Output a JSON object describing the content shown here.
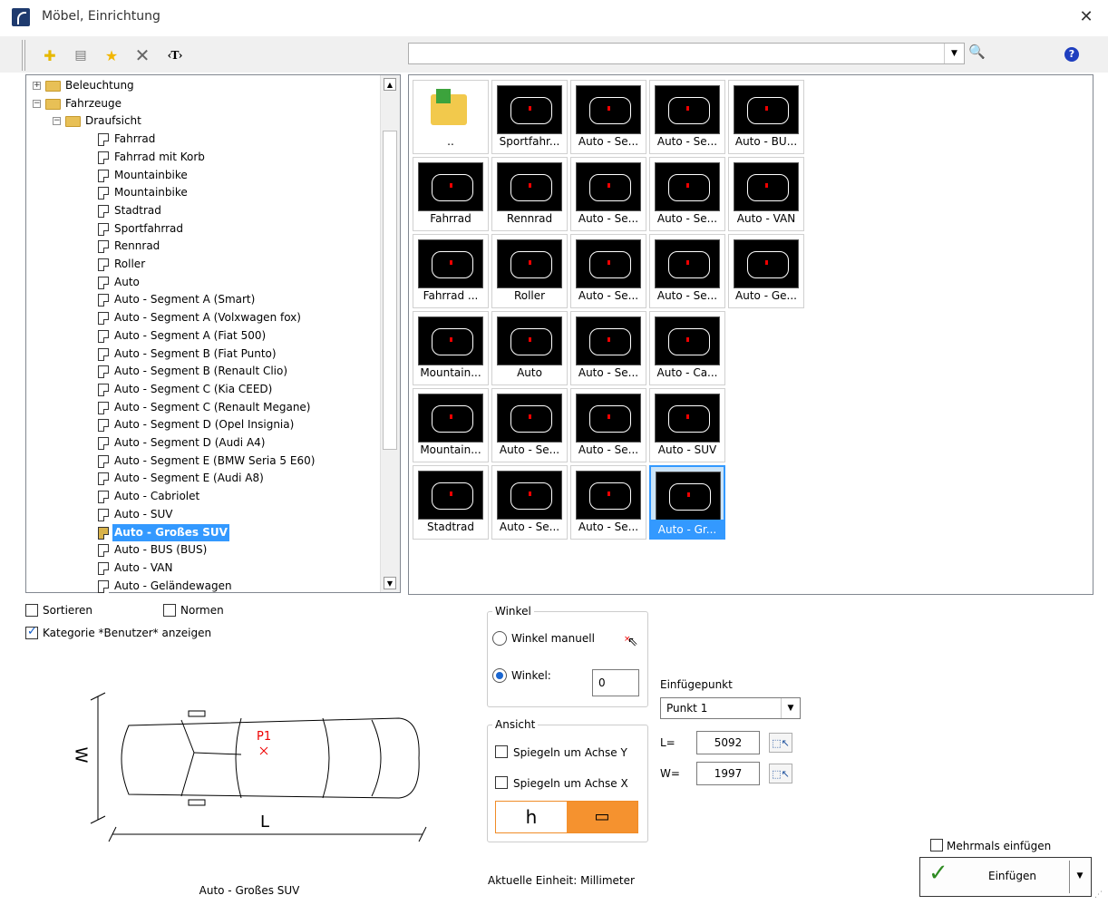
{
  "window": {
    "title": "Möbel, Einrichtung",
    "close_glyph": "✕"
  },
  "toolbar": {
    "buttons": [
      {
        "name": "add-icon",
        "glyph": "✚"
      },
      {
        "name": "properties-icon",
        "glyph": "▤"
      },
      {
        "name": "favorite-star-icon",
        "glyph": "★"
      },
      {
        "name": "delete-icon",
        "glyph": "✕"
      },
      {
        "name": "text-icon",
        "glyph": "‹T›"
      }
    ],
    "search_value": "",
    "search_glyph": "🔍",
    "help_glyph": "?"
  },
  "tree": {
    "nodes": [
      {
        "label": "Beleuchtung",
        "level": 0,
        "type": "folder",
        "toggle": "+"
      },
      {
        "label": "Fahrzeuge",
        "level": 0,
        "type": "folder",
        "toggle": "−"
      },
      {
        "label": "Draufsicht",
        "level": 1,
        "type": "folder",
        "toggle": "−"
      },
      {
        "label": "Fahrrad",
        "level": 2,
        "type": "doc"
      },
      {
        "label": "Fahrrad mit Korb",
        "level": 2,
        "type": "doc"
      },
      {
        "label": "Mountainbike",
        "level": 2,
        "type": "doc"
      },
      {
        "label": "Mountainbike",
        "level": 2,
        "type": "doc"
      },
      {
        "label": "Stadtrad",
        "level": 2,
        "type": "doc"
      },
      {
        "label": "Sportfahrrad",
        "level": 2,
        "type": "doc"
      },
      {
        "label": "Rennrad",
        "level": 2,
        "type": "doc"
      },
      {
        "label": "Roller",
        "level": 2,
        "type": "doc"
      },
      {
        "label": "Auto",
        "level": 2,
        "type": "doc"
      },
      {
        "label": "Auto - Segment A (Smart)",
        "level": 2,
        "type": "doc"
      },
      {
        "label": "Auto - Segment A (Volxwagen fox)",
        "level": 2,
        "type": "doc"
      },
      {
        "label": "Auto - Segment A (Fiat 500)",
        "level": 2,
        "type": "doc"
      },
      {
        "label": "Auto - Segment B (Fiat Punto)",
        "level": 2,
        "type": "doc"
      },
      {
        "label": "Auto - Segment B (Renault Clio)",
        "level": 2,
        "type": "doc"
      },
      {
        "label": "Auto - Segment C (Kia CEED)",
        "level": 2,
        "type": "doc"
      },
      {
        "label": "Auto - Segment C (Renault Megane)",
        "level": 2,
        "type": "doc"
      },
      {
        "label": "Auto - Segment D (Opel Insignia)",
        "level": 2,
        "type": "doc"
      },
      {
        "label": "Auto - Segment D (Audi A4)",
        "level": 2,
        "type": "doc"
      },
      {
        "label": "Auto - Segment E (BMW Seria 5 E60)",
        "level": 2,
        "type": "doc"
      },
      {
        "label": "Auto - Segment E (Audi A8)",
        "level": 2,
        "type": "doc"
      },
      {
        "label": "Auto - Cabriolet",
        "level": 2,
        "type": "doc"
      },
      {
        "label": "Auto - SUV",
        "level": 2,
        "type": "doc"
      },
      {
        "label": "Auto - Großes SUV",
        "level": 2,
        "type": "doc",
        "selected": true
      },
      {
        "label": "Auto - BUS (BUS)",
        "level": 2,
        "type": "doc"
      },
      {
        "label": "Auto - VAN",
        "level": 2,
        "type": "doc"
      },
      {
        "label": "Auto - Geländewagen",
        "level": 2,
        "type": "doc"
      }
    ],
    "scroll_up_glyph": "▲",
    "scroll_down_glyph": "▼"
  },
  "gallery": {
    "rows": [
      [
        "..",
        "Sportfahr...",
        "Auto - Se...",
        "Auto - Se...",
        "Auto - BU..."
      ],
      [
        "Fahrrad",
        "Rennrad",
        "Auto - Se...",
        "Auto - Se...",
        "Auto - VAN"
      ],
      [
        "Fahrrad ...",
        "Roller",
        "Auto - Se...",
        "Auto - Se...",
        "Auto - Ge..."
      ],
      [
        "Mountain...",
        "Auto",
        "Auto - Se...",
        "Auto - Ca..."
      ],
      [
        "Mountain...",
        "Auto - Se...",
        "Auto - Se...",
        "Auto - SUV"
      ],
      [
        "Stadtrad",
        "Auto - Se...",
        "Auto - Se...",
        "Auto - Gr..."
      ]
    ],
    "selected": "Auto - Gr..."
  },
  "options": {
    "sort_label": "Sortieren",
    "sort_checked": false,
    "norms_label": "Normen",
    "norms_checked": false,
    "user_category_label": "Kategorie *Benutzer* anzeigen",
    "user_category_checked": true
  },
  "preview": {
    "caption": "Auto - Großes SUV",
    "point_label": "P1",
    "dim_w": "W",
    "dim_l": "L"
  },
  "angle": {
    "group_label": "Winkel",
    "manual_label": "Winkel manuell",
    "angle_label": "Winkel:",
    "angle_value": "0",
    "selected": "angle"
  },
  "view": {
    "group_label": "Ansicht",
    "mirror_y_label": "Spiegeln um Achse Y",
    "mirror_x_label": "Spiegeln um Achse X",
    "toggle_left_glyph": "h",
    "toggle_right_glyph": "▭",
    "active": "right"
  },
  "insertion": {
    "label": "Einfügepunkt",
    "point_value": "Punkt 1",
    "l_label": "L=",
    "l_value": "5092",
    "w_label": "W=",
    "w_value": "1997"
  },
  "footer": {
    "unit_text": "Aktuelle Einheit: Millimeter",
    "multi_label": "Mehrmals einfügen",
    "multi_checked": false,
    "insert_label": "Einfügen",
    "accent": "#3399ff",
    "toggle_color": "#f5922f"
  }
}
